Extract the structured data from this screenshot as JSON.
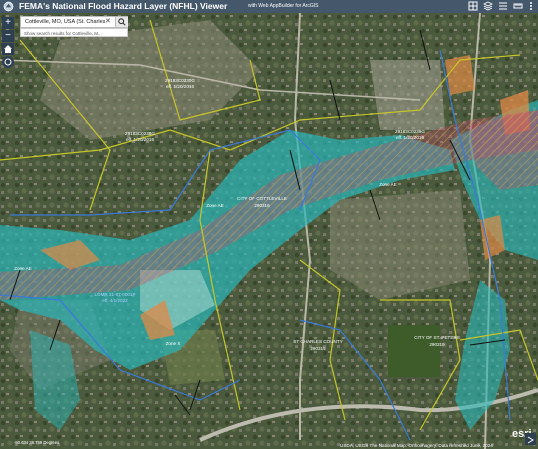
{
  "header": {
    "title": "FEMA's National Flood Hazard Layer (NFHL) Viewer",
    "subtitle": "with Web AppBuilder for ArcGIS"
  },
  "search": {
    "value": "Cottleville, MO, USA (St. Charles",
    "hint": "Show search results for Cottleville, M..."
  },
  "map": {
    "labels": [
      {
        "text": "29183C0230G",
        "color": "#ffffff"
      },
      {
        "text": "eff. 1/20/2016",
        "color": "#ffffff"
      },
      {
        "text": "29183C0238G",
        "color": "#ffffff"
      },
      {
        "text": "eff. 1/20/2016",
        "color": "#ffffff"
      },
      {
        "text": "29183C0239G",
        "color": "#ffffff"
      },
      {
        "text": "eff. 1/20/2016",
        "color": "#ffffff"
      },
      {
        "text": "CITY OF COTTLEVILLE",
        "color": "#ffffff"
      },
      {
        "text": "290316",
        "color": "#ffffff"
      },
      {
        "text": "ST CHARLES COUNTY",
        "color": "#ffffff"
      },
      {
        "text": "290315",
        "color": "#ffffff"
      },
      {
        "text": "Zone AE",
        "color": "#ffffff"
      },
      {
        "text": "Zone AE",
        "color": "#ffffff"
      },
      {
        "text": "Zone AE",
        "color": "#ffffff"
      },
      {
        "text": "Zone X",
        "color": "#ffffff"
      },
      {
        "text": "LOMR 21-07-0001P",
        "color": "#a8d4ff"
      },
      {
        "text": "eff. 4/1/2022",
        "color": "#a8d4ff"
      },
      {
        "text": "CITY OF ST. PETERS",
        "color": "#ffffff"
      },
      {
        "text": "290319",
        "color": "#ffffff"
      }
    ]
  },
  "footer": {
    "attribution": "USDA, USGS The National Map: Orthoimagery. Data refreshed June, 2024",
    "coords": "-90.634 38.759 Degrees",
    "esri": "esri"
  },
  "colors": {
    "header": "#44576b",
    "flood_zone": "#29b7b9",
    "panel_boundary": "#c6c52a",
    "jurisdiction": "#3a79d8",
    "orange_zone": "#e08a46"
  },
  "icons": [
    "search-icon",
    "zoom-in-icon",
    "zoom-out-icon",
    "home-icon",
    "locate-icon",
    "basemap-gallery-icon",
    "layer-list-icon",
    "legend-icon",
    "measure-icon",
    "overview-map-icon"
  ]
}
